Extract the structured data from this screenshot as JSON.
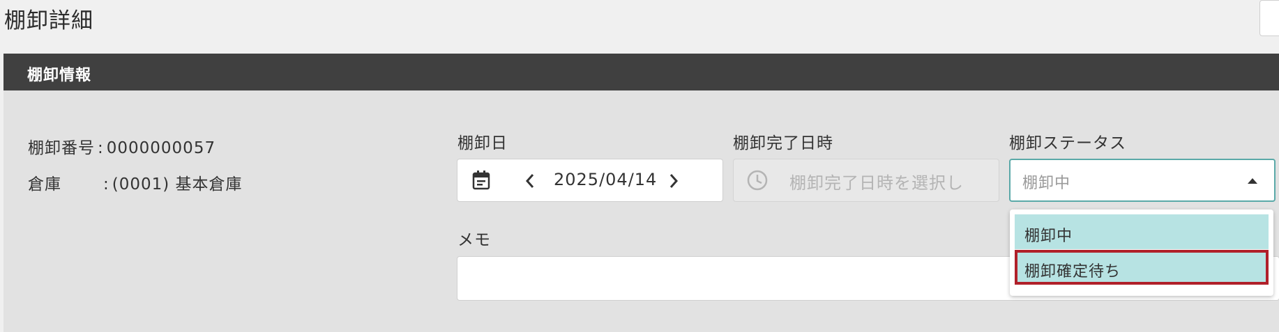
{
  "page": {
    "title": "棚卸詳細"
  },
  "panel": {
    "header": "棚卸情報",
    "info": {
      "number_label": "棚卸番号",
      "number_value": "0000000057",
      "warehouse_label": "倉庫",
      "warehouse_value": "(0001) 基本倉庫"
    },
    "fields": {
      "date_label": "棚卸日",
      "date_value": "2025/04/14",
      "complete_label": "棚卸完了日時",
      "complete_placeholder": "棚卸完了日時を選択し",
      "status_label": "棚卸ステータス",
      "status_value": "棚卸中",
      "memo_label": "メモ",
      "memo_value": ""
    },
    "status_options": [
      "棚卸中",
      "棚卸確定待ち"
    ]
  },
  "colors": {
    "header_bg": "#404040",
    "panel_bg": "#e2e2e2",
    "option_bg": "#b7e3e3",
    "highlight_border": "#b0202a",
    "focus_border": "#5aa9a8"
  },
  "icons": {
    "date_field": "calendar-icon",
    "prev": "chevron-left-icon",
    "next": "chevron-right-icon",
    "time_field": "clock-icon",
    "select": "caret-up-icon"
  }
}
